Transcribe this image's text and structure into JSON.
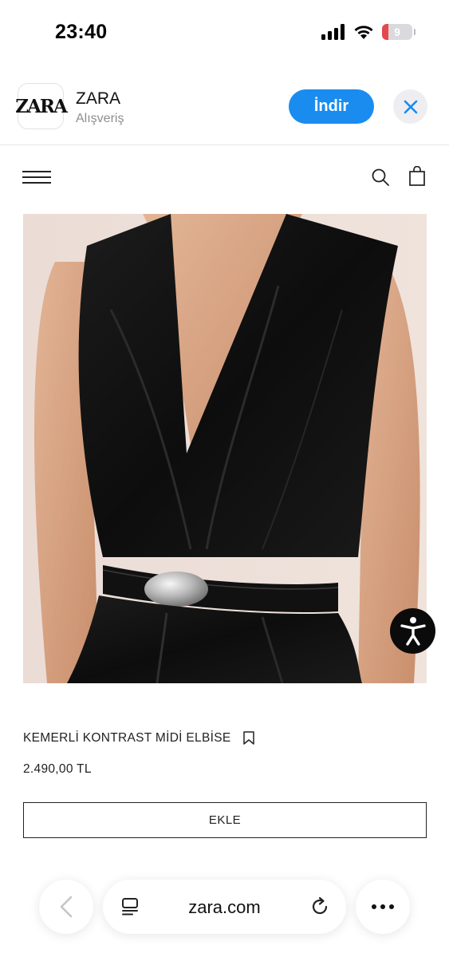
{
  "status_bar": {
    "time": "23:40",
    "battery_level": "9",
    "icons": [
      "signal-icon",
      "wifi-icon",
      "battery-icon"
    ]
  },
  "app_banner": {
    "app_icon_text": "ZARA",
    "app_name": "ZARA",
    "category": "Alışveriş",
    "get_button": "İndir",
    "close_icon": "close-icon",
    "accent_color": "#1a8cf0"
  },
  "site_header": {
    "menu_icon": "hamburger-menu-icon",
    "search_icon": "search-icon",
    "bag_icon": "shopping-bag-icon"
  },
  "product": {
    "image_description": "model-wearing-black-belted-dress",
    "title": "KEMERLİ KONTRAST MİDİ ELBİSE",
    "price": "2.490,00 TL",
    "add_button": "EKLE",
    "bookmark_icon": "bookmark-icon"
  },
  "accessibility": {
    "icon": "accessibility-icon"
  },
  "browser_bar": {
    "back_icon": "chevron-left-icon",
    "tabs_icon": "tabs-icon",
    "url": "zara.com",
    "reload_icon": "reload-icon",
    "more_icon": "more-icon"
  }
}
